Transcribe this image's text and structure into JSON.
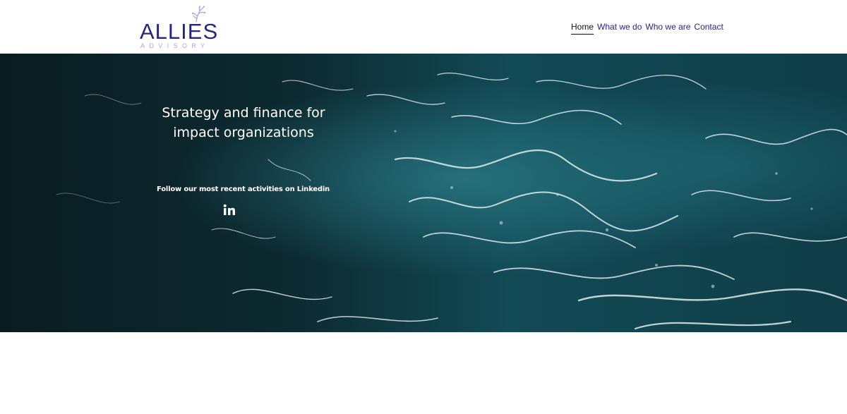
{
  "brand": {
    "name": "ALLIES",
    "tagline": "ADVISORY",
    "primary_color": "#262582",
    "accent_color": "#a9a4e0"
  },
  "nav": {
    "items": [
      {
        "label": "Home",
        "active": true
      },
      {
        "label": "What we do",
        "active": false
      },
      {
        "label": "Who we are",
        "active": false
      },
      {
        "label": "Contact",
        "active": false
      }
    ]
  },
  "hero": {
    "title": "Strategy and finance for impact organizations",
    "follow_text": "Follow our most recent activities on Linkedin",
    "social_icon": "linkedin-icon",
    "background": "ocean-waves-aerial"
  }
}
